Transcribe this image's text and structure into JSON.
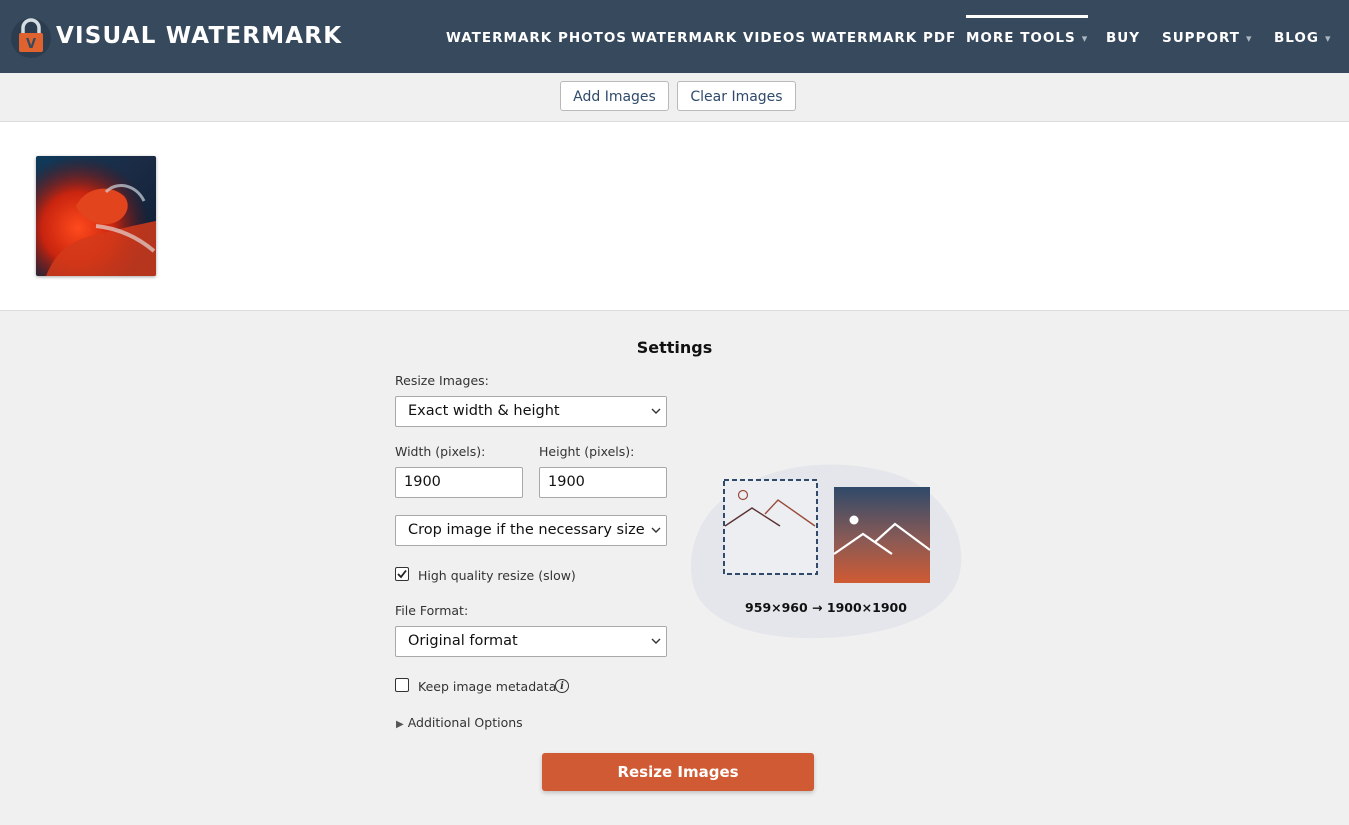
{
  "brand": {
    "name": "VISUAL WATERMARK",
    "logo_letter": "V"
  },
  "nav": [
    {
      "label": "WATERMARK PHOTOS",
      "caret": ""
    },
    {
      "label": "WATERMARK VIDEOS",
      "caret": ""
    },
    {
      "label": "WATERMARK PDF",
      "caret": ""
    },
    {
      "label": "MORE TOOLS",
      "caret": "▾"
    },
    {
      "label": "BUY",
      "caret": ""
    },
    {
      "label": "SUPPORT",
      "caret": "▾"
    },
    {
      "label": "BLOG",
      "caret": "▾"
    }
  ],
  "toolbar": {
    "add_label": "Add Images",
    "clear_label": "Clear Images"
  },
  "settings": {
    "title": "Settings",
    "resize_label": "Resize Images:",
    "resize_value": "Exact width & height",
    "width_label": "Width (pixels):",
    "width_value": "1900",
    "height_label": "Height (pixels):",
    "height_value": "1900",
    "crop_value": "Crop image if the necessary size re",
    "hq_label": "High quality resize (slow)",
    "hq_checked": true,
    "format_label": "File Format:",
    "format_value": "Original format",
    "metadata_label": "Keep image metadata",
    "metadata_checked": false,
    "info_glyph": "i",
    "additional_label": "Additional Options",
    "preview_dims": "959×960 → 1900×1900",
    "resize_button": "Resize Images"
  },
  "colors": {
    "header_bg": "#36495d",
    "accent": "#d05a33",
    "link_text": "#2f4a6a"
  }
}
